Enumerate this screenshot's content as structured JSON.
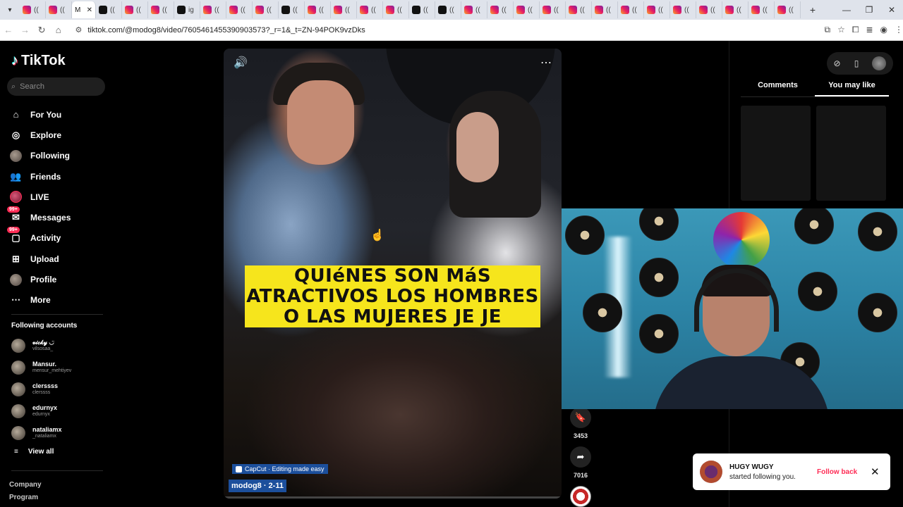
{
  "browser": {
    "active_tab_label": "M",
    "tabs": [
      {
        "icon": "ig",
        "label": "(("
      },
      {
        "icon": "ig",
        "label": "(("
      },
      {
        "icon": "tt",
        "label": "(("
      },
      {
        "icon": "ig",
        "label": "(("
      },
      {
        "icon": "ig",
        "label": "(("
      },
      {
        "icon": "tt",
        "label": "ig"
      },
      {
        "icon": "ig",
        "label": "(("
      },
      {
        "icon": "ig",
        "label": "(("
      },
      {
        "icon": "ig",
        "label": "(("
      },
      {
        "icon": "tt",
        "label": "(("
      },
      {
        "icon": "ig",
        "label": "(("
      },
      {
        "icon": "ig",
        "label": "(("
      },
      {
        "icon": "ig",
        "label": "(("
      },
      {
        "icon": "ig",
        "label": "(("
      },
      {
        "icon": "tt",
        "label": "(("
      },
      {
        "icon": "tt",
        "label": "(("
      },
      {
        "icon": "ig",
        "label": "(("
      },
      {
        "icon": "ig",
        "label": "(("
      },
      {
        "icon": "ig",
        "label": "(("
      },
      {
        "icon": "ig",
        "label": "(("
      },
      {
        "icon": "ig",
        "label": "(("
      },
      {
        "icon": "ig",
        "label": "(("
      },
      {
        "icon": "ig",
        "label": "(("
      },
      {
        "icon": "ig",
        "label": "(("
      },
      {
        "icon": "ig",
        "label": "(("
      },
      {
        "icon": "ig",
        "label": "(("
      },
      {
        "icon": "ig",
        "label": "(("
      },
      {
        "icon": "ig",
        "label": "(("
      },
      {
        "icon": "ig",
        "label": "(("
      }
    ],
    "url": "tiktok.com/@modog8/video/7605461455390903573?_r=1&_t=ZN-94POK9vzDks"
  },
  "tiktok": {
    "logo": "TikTok",
    "search_placeholder": "Search",
    "nav": [
      {
        "label": "For You",
        "icon": "home-icon"
      },
      {
        "label": "Explore",
        "icon": "compass-icon"
      },
      {
        "label": "Following",
        "icon": "avatar"
      },
      {
        "label": "Friends",
        "icon": "friends-icon"
      },
      {
        "label": "LIVE",
        "icon": "live-avatar"
      },
      {
        "label": "Messages",
        "icon": "inbox-icon",
        "badge": "99+"
      },
      {
        "label": "Activity",
        "icon": "activity-icon",
        "badge": "99+"
      },
      {
        "label": "Upload",
        "icon": "upload-icon"
      },
      {
        "label": "Profile",
        "icon": "avatar"
      },
      {
        "label": "More",
        "icon": "more-icon"
      }
    ],
    "following_title": "Following accounts",
    "accounts": [
      {
        "name": "𝓋𝒾𝒸𝓀𝓎 ◡̈",
        "handle": "vilsosaa_"
      },
      {
        "name": "Mansur.",
        "handle": "mensur_mehtiyev"
      },
      {
        "name": "clerssss",
        "handle": "clerssss"
      },
      {
        "name": "edurnyx",
        "handle": "edurnyx"
      },
      {
        "name": "nataliamx",
        "handle": "_nataliamx"
      }
    ],
    "view_all": "View all",
    "footer": [
      "Company",
      "Program"
    ]
  },
  "video": {
    "caption_lines": [
      "QUIéNES SON MáS",
      "ATRACTIVOS LOS HOMBRES",
      "O LAS MUJERES JE JE"
    ],
    "capcut": "CapCut · Editing made easy",
    "author_line": "modog8 · 2-11",
    "progress": 0.0
  },
  "actions": {
    "bookmarks": "3453",
    "shares": "7016"
  },
  "right_panel": {
    "tabs": [
      "Comments",
      "You may like"
    ],
    "active_tab": "You may like"
  },
  "toast": {
    "name": "HUGY WUGY",
    "message": "started following you.",
    "action": "Follow back"
  },
  "colors": {
    "accent": "#fe2c55",
    "caption_bg": "#f6e51c",
    "capcut_bg": "#1c4f9c"
  }
}
